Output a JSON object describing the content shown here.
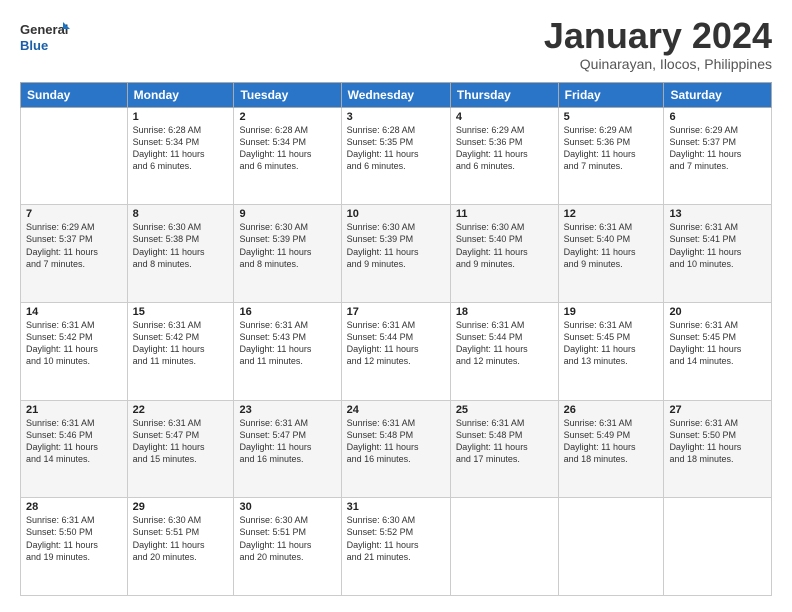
{
  "header": {
    "logo_line1": "General",
    "logo_line2": "Blue",
    "month_title": "January 2024",
    "subtitle": "Quinarayan, Ilocos, Philippines"
  },
  "days_of_week": [
    "Sunday",
    "Monday",
    "Tuesday",
    "Wednesday",
    "Thursday",
    "Friday",
    "Saturday"
  ],
  "weeks": [
    [
      {
        "day": "",
        "info": ""
      },
      {
        "day": "1",
        "info": "Sunrise: 6:28 AM\nSunset: 5:34 PM\nDaylight: 11 hours\nand 6 minutes."
      },
      {
        "day": "2",
        "info": "Sunrise: 6:28 AM\nSunset: 5:34 PM\nDaylight: 11 hours\nand 6 minutes."
      },
      {
        "day": "3",
        "info": "Sunrise: 6:28 AM\nSunset: 5:35 PM\nDaylight: 11 hours\nand 6 minutes."
      },
      {
        "day": "4",
        "info": "Sunrise: 6:29 AM\nSunset: 5:36 PM\nDaylight: 11 hours\nand 6 minutes."
      },
      {
        "day": "5",
        "info": "Sunrise: 6:29 AM\nSunset: 5:36 PM\nDaylight: 11 hours\nand 7 minutes."
      },
      {
        "day": "6",
        "info": "Sunrise: 6:29 AM\nSunset: 5:37 PM\nDaylight: 11 hours\nand 7 minutes."
      }
    ],
    [
      {
        "day": "7",
        "info": "Sunrise: 6:29 AM\nSunset: 5:37 PM\nDaylight: 11 hours\nand 7 minutes."
      },
      {
        "day": "8",
        "info": "Sunrise: 6:30 AM\nSunset: 5:38 PM\nDaylight: 11 hours\nand 8 minutes."
      },
      {
        "day": "9",
        "info": "Sunrise: 6:30 AM\nSunset: 5:39 PM\nDaylight: 11 hours\nand 8 minutes."
      },
      {
        "day": "10",
        "info": "Sunrise: 6:30 AM\nSunset: 5:39 PM\nDaylight: 11 hours\nand 9 minutes."
      },
      {
        "day": "11",
        "info": "Sunrise: 6:30 AM\nSunset: 5:40 PM\nDaylight: 11 hours\nand 9 minutes."
      },
      {
        "day": "12",
        "info": "Sunrise: 6:31 AM\nSunset: 5:40 PM\nDaylight: 11 hours\nand 9 minutes."
      },
      {
        "day": "13",
        "info": "Sunrise: 6:31 AM\nSunset: 5:41 PM\nDaylight: 11 hours\nand 10 minutes."
      }
    ],
    [
      {
        "day": "14",
        "info": "Sunrise: 6:31 AM\nSunset: 5:42 PM\nDaylight: 11 hours\nand 10 minutes."
      },
      {
        "day": "15",
        "info": "Sunrise: 6:31 AM\nSunset: 5:42 PM\nDaylight: 11 hours\nand 11 minutes."
      },
      {
        "day": "16",
        "info": "Sunrise: 6:31 AM\nSunset: 5:43 PM\nDaylight: 11 hours\nand 11 minutes."
      },
      {
        "day": "17",
        "info": "Sunrise: 6:31 AM\nSunset: 5:44 PM\nDaylight: 11 hours\nand 12 minutes."
      },
      {
        "day": "18",
        "info": "Sunrise: 6:31 AM\nSunset: 5:44 PM\nDaylight: 11 hours\nand 12 minutes."
      },
      {
        "day": "19",
        "info": "Sunrise: 6:31 AM\nSunset: 5:45 PM\nDaylight: 11 hours\nand 13 minutes."
      },
      {
        "day": "20",
        "info": "Sunrise: 6:31 AM\nSunset: 5:45 PM\nDaylight: 11 hours\nand 14 minutes."
      }
    ],
    [
      {
        "day": "21",
        "info": "Sunrise: 6:31 AM\nSunset: 5:46 PM\nDaylight: 11 hours\nand 14 minutes."
      },
      {
        "day": "22",
        "info": "Sunrise: 6:31 AM\nSunset: 5:47 PM\nDaylight: 11 hours\nand 15 minutes."
      },
      {
        "day": "23",
        "info": "Sunrise: 6:31 AM\nSunset: 5:47 PM\nDaylight: 11 hours\nand 16 minutes."
      },
      {
        "day": "24",
        "info": "Sunrise: 6:31 AM\nSunset: 5:48 PM\nDaylight: 11 hours\nand 16 minutes."
      },
      {
        "day": "25",
        "info": "Sunrise: 6:31 AM\nSunset: 5:48 PM\nDaylight: 11 hours\nand 17 minutes."
      },
      {
        "day": "26",
        "info": "Sunrise: 6:31 AM\nSunset: 5:49 PM\nDaylight: 11 hours\nand 18 minutes."
      },
      {
        "day": "27",
        "info": "Sunrise: 6:31 AM\nSunset: 5:50 PM\nDaylight: 11 hours\nand 18 minutes."
      }
    ],
    [
      {
        "day": "28",
        "info": "Sunrise: 6:31 AM\nSunset: 5:50 PM\nDaylight: 11 hours\nand 19 minutes."
      },
      {
        "day": "29",
        "info": "Sunrise: 6:30 AM\nSunset: 5:51 PM\nDaylight: 11 hours\nand 20 minutes."
      },
      {
        "day": "30",
        "info": "Sunrise: 6:30 AM\nSunset: 5:51 PM\nDaylight: 11 hours\nand 20 minutes."
      },
      {
        "day": "31",
        "info": "Sunrise: 6:30 AM\nSunset: 5:52 PM\nDaylight: 11 hours\nand 21 minutes."
      },
      {
        "day": "",
        "info": ""
      },
      {
        "day": "",
        "info": ""
      },
      {
        "day": "",
        "info": ""
      }
    ]
  ]
}
